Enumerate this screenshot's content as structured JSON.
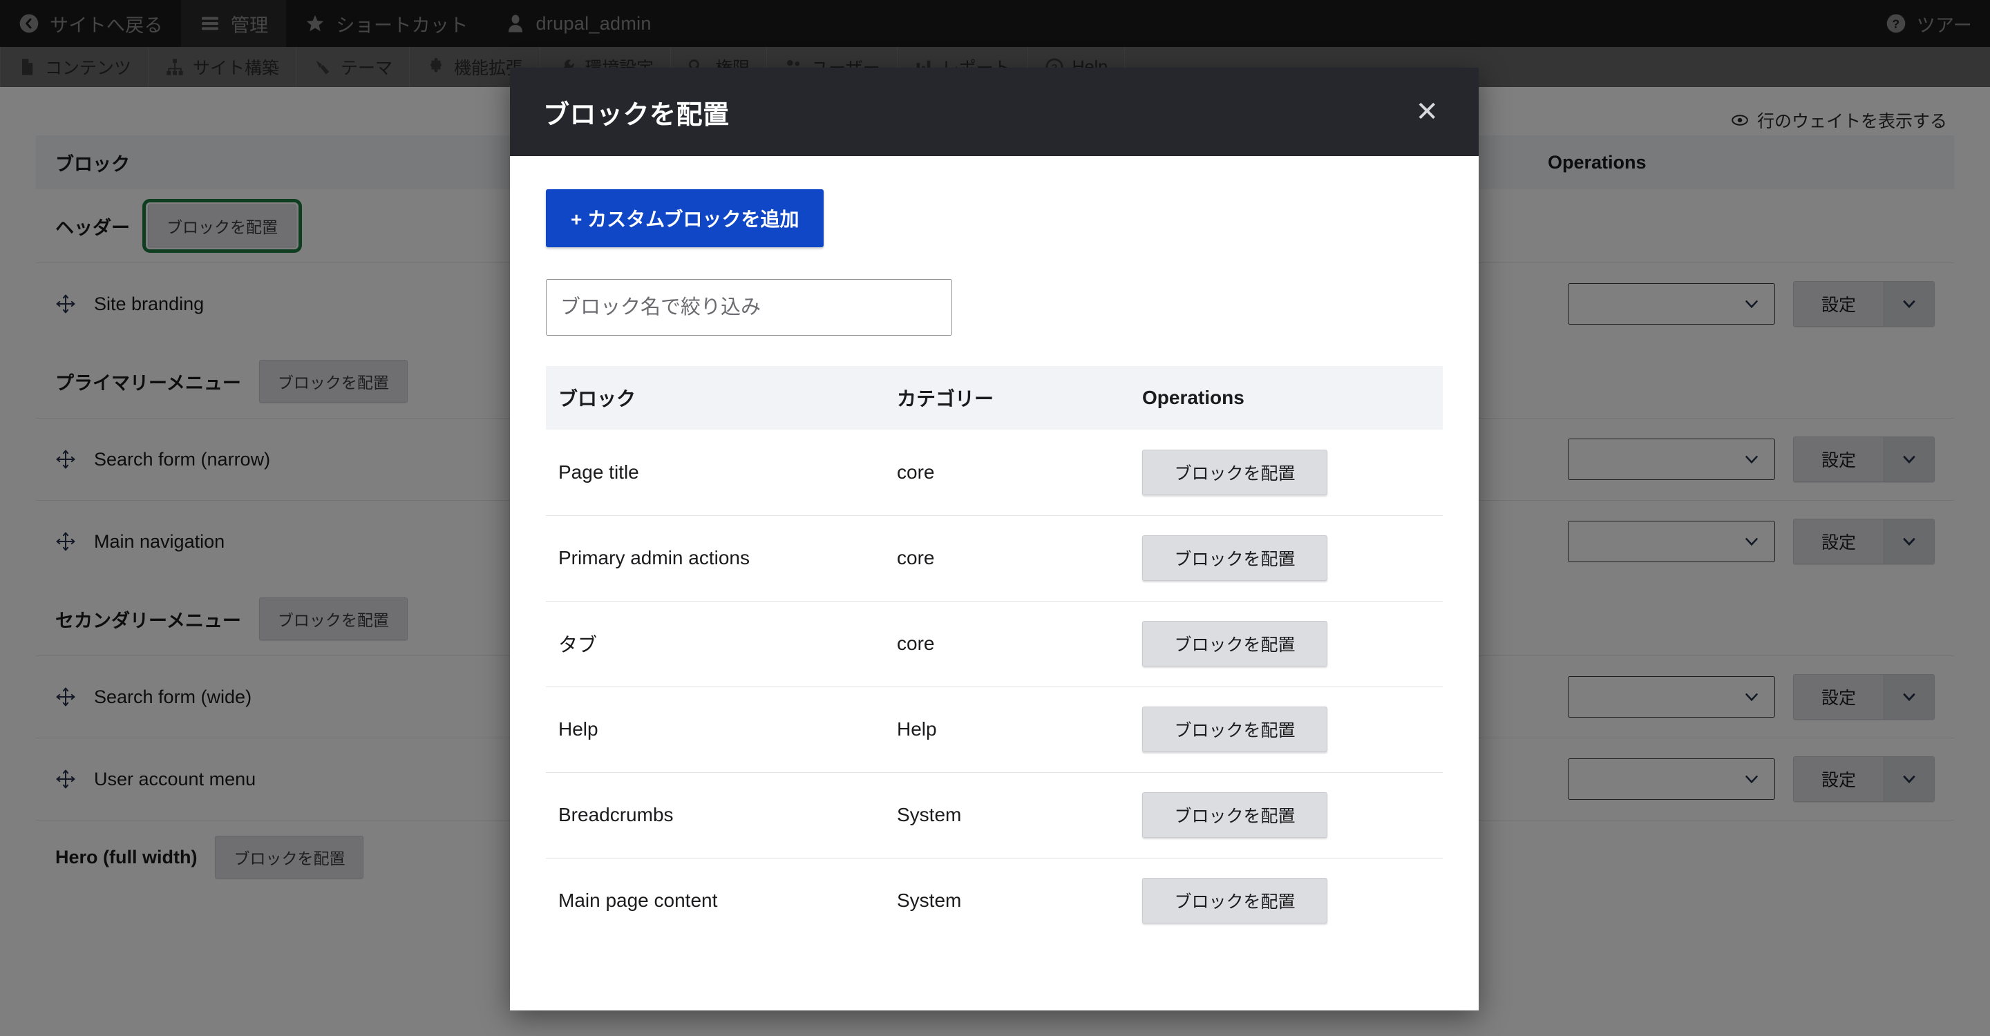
{
  "toolbar": {
    "items": [
      {
        "label": "サイトへ戻る",
        "icon": "back-circle-icon",
        "active": false
      },
      {
        "label": "管理",
        "icon": "hamburger-icon",
        "active": true
      },
      {
        "label": "ショートカット",
        "icon": "star-icon",
        "active": false
      },
      {
        "label": "drupal_admin",
        "icon": "user-icon",
        "active": false
      }
    ],
    "tour": {
      "label": "ツアー",
      "icon": "help-circle-icon"
    }
  },
  "admin_menu": {
    "items": [
      {
        "label": "コンテンツ",
        "icon": "file-icon"
      },
      {
        "label": "サイト構築",
        "icon": "sitemap-icon"
      },
      {
        "label": "テーマ",
        "icon": "brush-icon"
      },
      {
        "label": "機能拡張",
        "icon": "puzzle-icon"
      },
      {
        "label": "環境設定",
        "icon": "wrench-icon"
      },
      {
        "label": "権限",
        "icon": "key-icon"
      },
      {
        "label": "ユーザー",
        "icon": "people-icon"
      },
      {
        "label": "レポート",
        "icon": "chart-icon"
      },
      {
        "label": "Help",
        "icon": "help-icon"
      }
    ]
  },
  "page": {
    "weight_toggle_label": "行のウェイトを表示する",
    "weight_toggle_icon": "eye-icon",
    "table_headers": {
      "block": "ブロック",
      "operations": "Operations"
    },
    "place_block_label": "ブロックを配置",
    "configure_label": "設定",
    "rows": [
      {
        "type": "region",
        "label": "ヘッダー",
        "button": "ブロックを配置",
        "focused": true
      },
      {
        "type": "block",
        "label": "Site branding",
        "drag": "drag-handle-icon",
        "configure": "設定"
      },
      {
        "type": "region",
        "label": "プライマリーメニュー",
        "button": "ブロックを配置",
        "focused": false
      },
      {
        "type": "block",
        "label": "Search form (narrow)",
        "drag": "drag-handle-icon",
        "configure": "設定"
      },
      {
        "type": "block",
        "label": "Main navigation",
        "drag": "drag-handle-icon",
        "configure": "設定"
      },
      {
        "type": "region",
        "label": "セカンダリーメニュー",
        "button": "ブロックを配置",
        "focused": false
      },
      {
        "type": "block",
        "label": "Search form (wide)",
        "drag": "drag-handle-icon",
        "configure": "設定"
      },
      {
        "type": "block",
        "label": "User account menu",
        "drag": "drag-handle-icon",
        "configure": "設定"
      },
      {
        "type": "region",
        "label": "Hero (full width)",
        "button": "ブロックを配置",
        "focused": false
      }
    ]
  },
  "modal": {
    "title": "ブロックを配置",
    "close_icon": "close-icon",
    "add_custom_block_label": "+ カスタムブロックを追加",
    "filter": {
      "placeholder": "ブロック名で絞り込み",
      "value": ""
    },
    "table": {
      "headers": [
        "ブロック",
        "カテゴリー",
        "Operations"
      ],
      "action_label": "ブロックを配置",
      "rows": [
        {
          "block": "Page title",
          "category": "core",
          "action": "ブロックを配置"
        },
        {
          "block": "Primary admin actions",
          "category": "core",
          "action": "ブロックを配置"
        },
        {
          "block": "タブ",
          "category": "core",
          "action": "ブロックを配置"
        },
        {
          "block": "Help",
          "category": "Help",
          "action": "ブロックを配置"
        },
        {
          "block": "Breadcrumbs",
          "category": "System",
          "action": "ブロックを配置"
        },
        {
          "block": "Main page content",
          "category": "System",
          "action": "ブロックを配置"
        }
      ]
    }
  },
  "colors": {
    "toolbar_bg": "#1b1b1d",
    "adminmenu_bg": "#6a6a6c",
    "modal_header_bg": "#26272d",
    "primary_button": "#0f47c7",
    "focus_outline": "#1f7a3f"
  }
}
